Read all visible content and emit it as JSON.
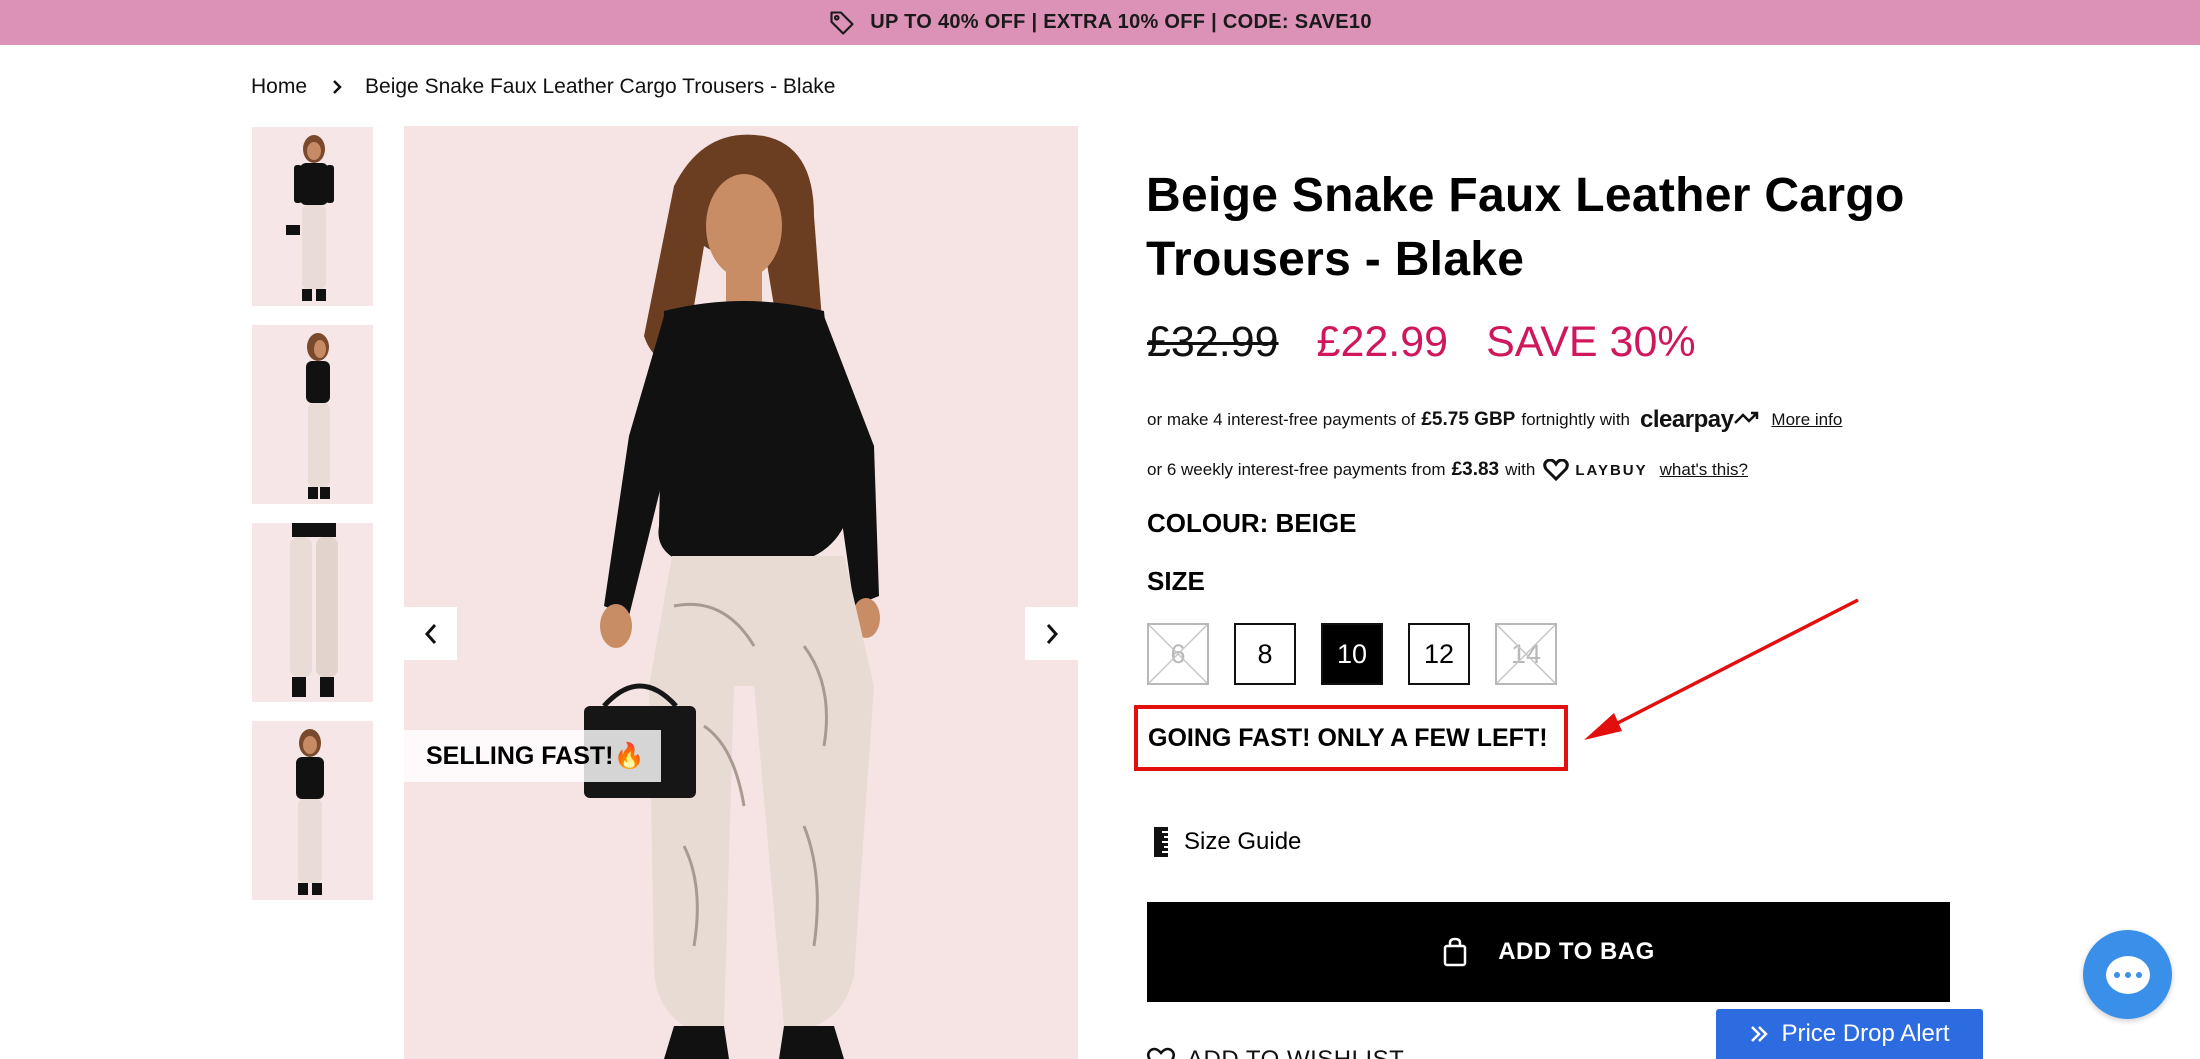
{
  "promo": {
    "text": "UP TO 40% OFF | EXTRA 10% OFF | CODE: SAVE10",
    "icon": "tag-icon"
  },
  "breadcrumb": {
    "home": "Home",
    "current": "Beige Snake Faux Leather Cargo Trousers - Blake"
  },
  "gallery": {
    "thumbnails": [
      "front",
      "side",
      "detail",
      "front-full"
    ],
    "badge": "SELLING FAST!🔥",
    "prev_icon": "chevron-left-icon",
    "next_icon": "chevron-right-icon"
  },
  "product": {
    "title_line1": "Beige Snake Faux Leather Cargo",
    "title_line2": "Trousers - Blake",
    "price_old": "£32.99",
    "price_new": "£22.99",
    "save": "SAVE 30%",
    "colors": {
      "sale": "#d0175e",
      "promo_bar": "#dc91b6",
      "annotation": "#e30f0f",
      "price_drop": "#2d6be0",
      "chat": "#3a8fe8"
    }
  },
  "payments": {
    "clearpay": {
      "prefix": "or make 4 interest-free payments of",
      "amount": "£5.75 GBP",
      "middle": "fortnightly with",
      "logo": "clearpay",
      "link": "More info"
    },
    "laybuy": {
      "prefix": "or 6 weekly interest-free payments from",
      "amount": "£3.83",
      "middle": "with",
      "logo": "LAYBUY",
      "link": "what's this?"
    }
  },
  "colour": {
    "label": "COLOUR: BEIGE"
  },
  "size": {
    "label": "SIZE",
    "options": [
      {
        "label": "6",
        "state": "unavailable"
      },
      {
        "label": "8",
        "state": "available"
      },
      {
        "label": "10",
        "state": "selected"
      },
      {
        "label": "12",
        "state": "available"
      },
      {
        "label": "14",
        "state": "unavailable"
      }
    ]
  },
  "stock_message": "GOING FAST! ONLY A FEW LEFT!",
  "size_guide": {
    "label": "Size Guide",
    "icon": "ruler-icon"
  },
  "add_to_bag": {
    "label": "ADD TO BAG",
    "icon": "shopping-bag-icon"
  },
  "wishlist": {
    "label": "ADD TO WISHLIST",
    "icon": "heart-icon"
  },
  "price_drop": {
    "label": "Price Drop Alert",
    "icon": "double-chevron-right-icon"
  },
  "chat": {
    "icon": "chat-icon"
  }
}
